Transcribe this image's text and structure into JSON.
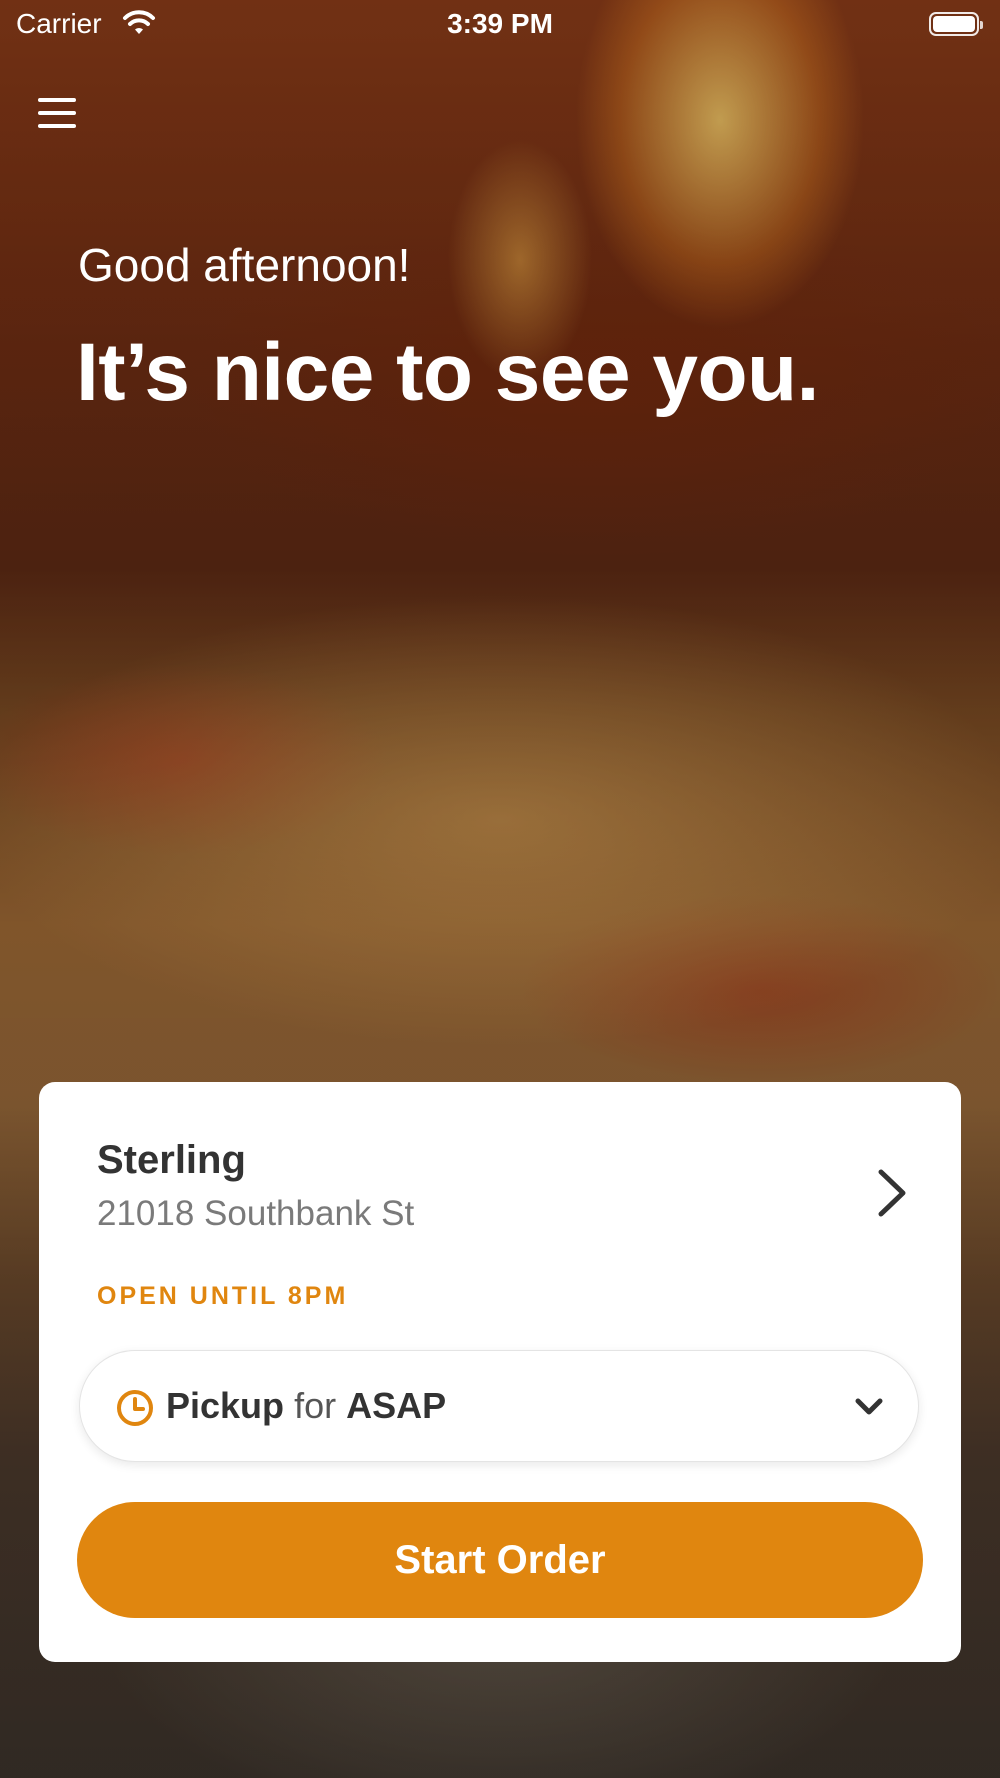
{
  "status_bar": {
    "carrier": "Carrier",
    "time": "3:39 PM"
  },
  "header": {
    "menu_icon": "hamburger-menu-icon"
  },
  "hero": {
    "greeting": "Good afternoon!",
    "headline": "It’s nice to see you."
  },
  "store": {
    "name": "Sterling",
    "address": "21018 Southbank St",
    "hours": "OPEN UNTIL 8PM"
  },
  "order_options": {
    "mode": "Pickup",
    "connector": "for",
    "time": "ASAP"
  },
  "start_button": {
    "label": "Start Order"
  },
  "colors": {
    "accent": "#e0860f",
    "card_background": "#ffffff",
    "store_name_text": "#333333",
    "address_text": "#7a7a7a"
  }
}
